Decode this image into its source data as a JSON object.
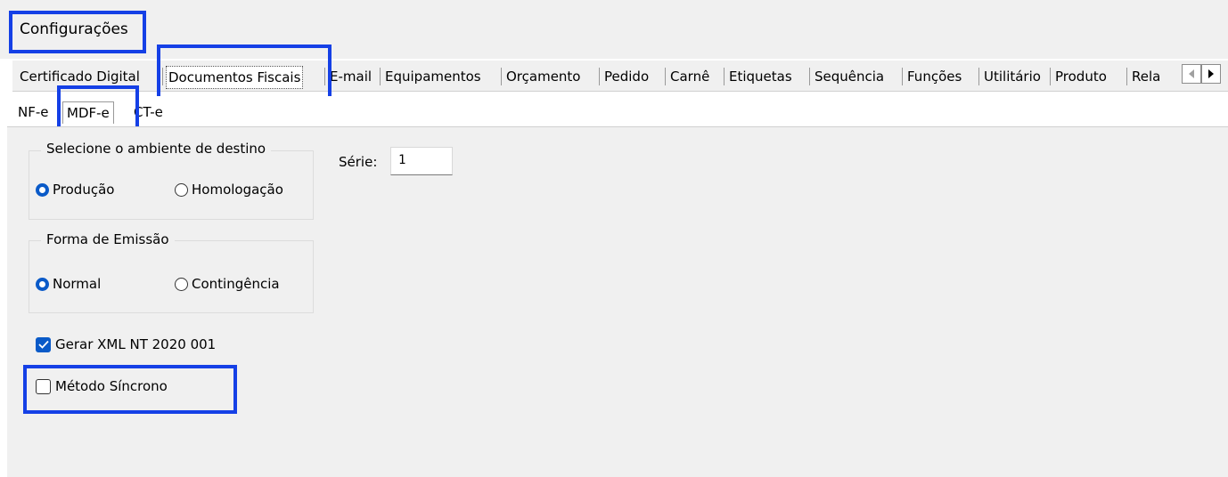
{
  "window": {
    "title": "Configurações"
  },
  "tabs": [
    {
      "label": "Certificado Digital"
    },
    {
      "label": "Documentos Fiscais"
    },
    {
      "label": "E-mail"
    },
    {
      "label": "Equipamentos"
    },
    {
      "label": "Orçamento"
    },
    {
      "label": "Pedido"
    },
    {
      "label": "Carnê"
    },
    {
      "label": "Etiquetas"
    },
    {
      "label": "Sequência"
    },
    {
      "label": "Funções"
    },
    {
      "label": "Utilitário"
    },
    {
      "label": "Produto"
    },
    {
      "label": "Rela"
    }
  ],
  "active_tab": "Documentos Fiscais",
  "subtabs": [
    {
      "label": "NF-e"
    },
    {
      "label": "MDF-e"
    },
    {
      "label": "CT-e"
    }
  ],
  "active_subtab": "MDF-e",
  "ambiente": {
    "title": "Selecione o ambiente de destino",
    "options": [
      {
        "label": "Produção",
        "selected": true
      },
      {
        "label": "Homologação",
        "selected": false
      }
    ]
  },
  "emissao": {
    "title": "Forma de Emissão",
    "options": [
      {
        "label": "Normal",
        "selected": true
      },
      {
        "label": "Contingência",
        "selected": false
      }
    ]
  },
  "serie": {
    "label": "Série:",
    "value": "1"
  },
  "checkboxes": [
    {
      "label": "Gerar XML NT 2020 001",
      "checked": true
    },
    {
      "label": "Método Síncrono",
      "checked": false
    }
  ],
  "colors": {
    "accent": "#0a5ac8",
    "highlight": "#1540e6",
    "background": "#f0f0f0"
  },
  "icons": {
    "scroll_left": "chevron-left-icon",
    "scroll_right": "chevron-right-icon"
  }
}
